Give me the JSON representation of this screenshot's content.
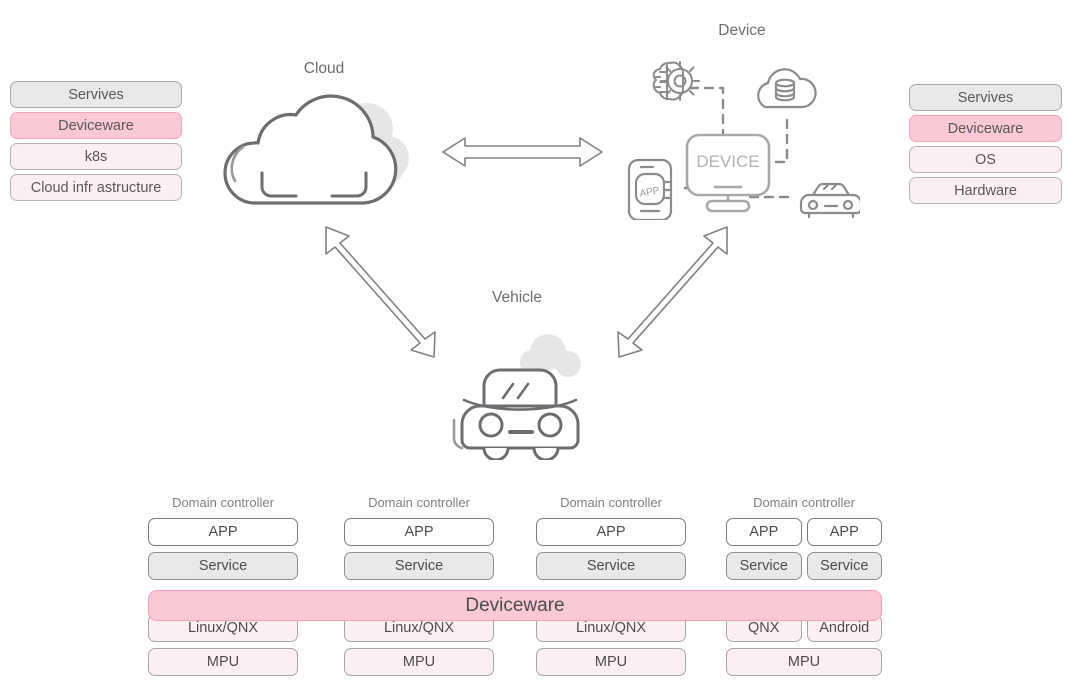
{
  "left_stack": {
    "name": "cloud-layer-stack",
    "items": [
      {
        "label": "Servives",
        "style": "gray"
      },
      {
        "label": "Deviceware",
        "style": "pink"
      },
      {
        "label": "k8s",
        "style": "lpink"
      },
      {
        "label": "Cloud infr astructure",
        "style": "lpink"
      }
    ]
  },
  "right_stack": {
    "name": "device-layer-stack",
    "items": [
      {
        "label": "Servives",
        "style": "gray"
      },
      {
        "label": "Deviceware",
        "style": "pink"
      },
      {
        "label": "OS",
        "style": "lpink"
      },
      {
        "label": "Hardware",
        "style": "lpink"
      }
    ]
  },
  "nodes": {
    "cloud": {
      "title": "Cloud",
      "icon": "cloud-icon"
    },
    "device": {
      "title": "Device",
      "icon": "device-monitor-icon",
      "monitor_label": "DEVICE",
      "satellites": [
        "ai-brain-gear-icon",
        "cloud-database-icon",
        "phone-app-icon",
        "car-icon"
      ],
      "phone_label": "APP"
    },
    "vehicle": {
      "title": "Vehicle",
      "icon": "car-front-icon"
    }
  },
  "arrows": [
    {
      "name": "arrow-cloud-device",
      "direction": "bidirectional"
    },
    {
      "name": "arrow-cloud-vehicle",
      "direction": "bidirectional"
    },
    {
      "name": "arrow-device-vehicle",
      "direction": "bidirectional"
    }
  ],
  "deviceware_bar": {
    "label": "Deviceware"
  },
  "domain_controllers": [
    {
      "label": "Domain controller",
      "app": [
        "APP"
      ],
      "service": [
        "Service"
      ],
      "os": [
        "Linux/QNX"
      ],
      "mpu": [
        "MPU"
      ]
    },
    {
      "label": "Domain controller",
      "app": [
        "APP"
      ],
      "service": [
        "Service"
      ],
      "os": [
        "Linux/QNX"
      ],
      "mpu": [
        "MPU"
      ]
    },
    {
      "label": "Domain controller",
      "app": [
        "APP"
      ],
      "service": [
        "Service"
      ],
      "os": [
        "Linux/QNX"
      ],
      "mpu": [
        "MPU"
      ]
    },
    {
      "label": "Domain controller",
      "app": [
        "APP",
        "APP"
      ],
      "service": [
        "Service",
        "Service"
      ],
      "os": [
        "QNX",
        "Android"
      ],
      "mpu": [
        "MPU"
      ]
    }
  ],
  "colors": {
    "pink_fill": "#fbc8d6",
    "pink_border": "#f59fb8",
    "light_pink_fill": "#fdeef1",
    "gray_fill": "#e9e9e9",
    "stroke": "#6d6e71",
    "text": "#58595b"
  }
}
